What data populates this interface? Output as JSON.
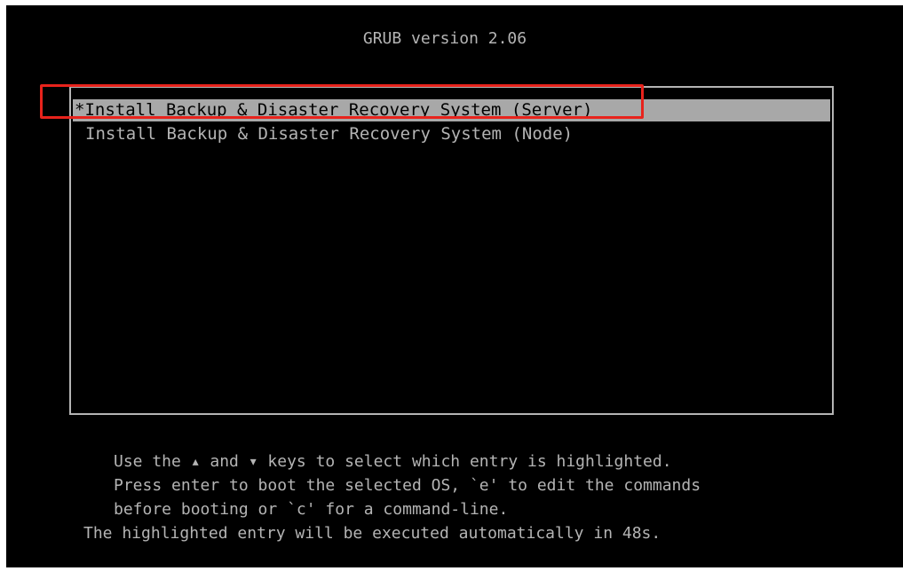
{
  "title": "GRUB version 2.06",
  "menu": {
    "entries": [
      {
        "label": "*Install Backup & Disaster Recovery System (Server)",
        "selected": true
      },
      {
        "label": "Install Backup & Disaster Recovery System (Node)",
        "selected": false
      }
    ]
  },
  "help": {
    "line1": "Use the ▴ and ▾ keys to select which entry is highlighted.",
    "line2": "Press enter to boot the selected OS, `e' to edit the commands",
    "line3": "before booting or `c' for a command-line.",
    "line4": "The highlighted entry will be executed automatically in 48s."
  },
  "colors": {
    "background": "#000000",
    "text": "#b4b4b4",
    "selection_bg": "#a8a8a8",
    "annotation": "#e8231c"
  }
}
